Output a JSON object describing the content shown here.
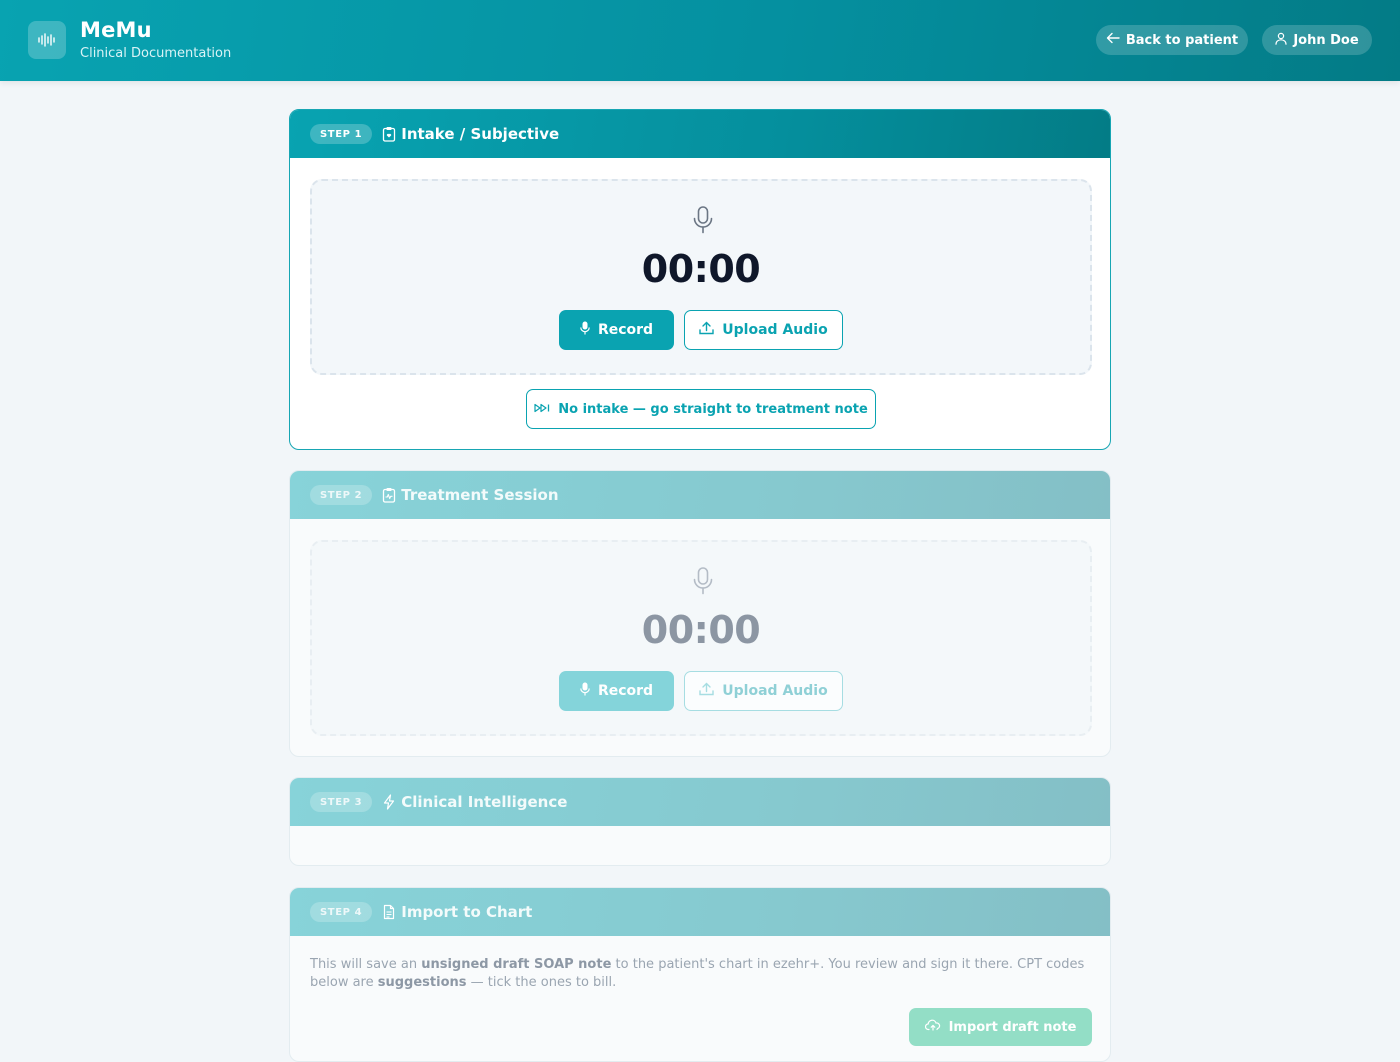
{
  "header": {
    "brand_title": "MeMu",
    "brand_subtitle": "Clinical Documentation",
    "logo_icon": "waveform-icon",
    "back_button": "Back to patient",
    "user_button": "John Doe"
  },
  "steps": [
    {
      "badge": "STEP 1",
      "title": "Intake / Subjective",
      "icon": "clipboard-heart-icon",
      "state": "active",
      "timer": "00:00",
      "record_label": "Record",
      "upload_label": "Upload Audio",
      "skip_label": "No intake — go straight to treatment note"
    },
    {
      "badge": "STEP 2",
      "title": "Treatment Session",
      "icon": "clipboard-pulse-icon",
      "state": "disabled",
      "timer": "00:00",
      "record_label": "Record",
      "upload_label": "Upload Audio"
    },
    {
      "badge": "STEP 3",
      "title": "Clinical Intelligence",
      "icon": "lightning-icon",
      "state": "disabled"
    },
    {
      "badge": "STEP 4",
      "title": "Import to Chart",
      "icon": "document-icon",
      "state": "disabled",
      "text_1": "This will save an ",
      "text_bold_1": "unsigned draft SOAP note",
      "text_2": " to the patient's chart in ezehr+. You review and sign it there. CPT codes below are ",
      "text_bold_2": "suggestions",
      "text_3": " — tick the ones to bill.",
      "import_label": "Import draft note"
    }
  ],
  "colors": {
    "primary": "#0aa3b1",
    "primary_dark": "#037b86",
    "disabled_header": "#87d3d9",
    "import_disabled": "#93dec6",
    "background": "#f2f6f9"
  }
}
